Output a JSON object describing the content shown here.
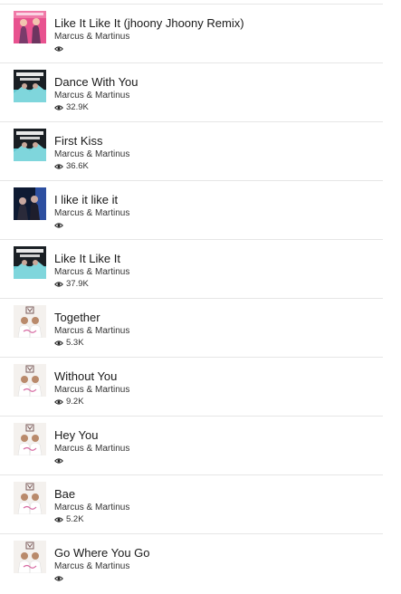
{
  "tracks": [
    {
      "title": "Like It Like It (jhoony Jhoony Remix)",
      "artist": "Marcus & Martinus",
      "plays": "",
      "art": "pink"
    },
    {
      "title": "Dance With You",
      "artist": "Marcus & Martinus",
      "plays": "32.9K",
      "art": "moment"
    },
    {
      "title": "First Kiss",
      "artist": "Marcus & Martinus",
      "plays": "36.6K",
      "art": "moment"
    },
    {
      "title": "I like it like it",
      "artist": "Marcus & Martinus",
      "plays": "",
      "art": "dark"
    },
    {
      "title": "Like It Like It",
      "artist": "Marcus & Martinus",
      "plays": "37.9K",
      "art": "moment"
    },
    {
      "title": "Together",
      "artist": "Marcus & Martinus",
      "plays": "5.3K",
      "art": "light"
    },
    {
      "title": "Without You",
      "artist": "Marcus & Martinus",
      "plays": "9.2K",
      "art": "light"
    },
    {
      "title": "Hey You",
      "artist": "Marcus & Martinus",
      "plays": "",
      "art": "light"
    },
    {
      "title": "Bae",
      "artist": "Marcus & Martinus",
      "plays": "5.2K",
      "art": "light"
    },
    {
      "title": "Go Where You Go",
      "artist": "Marcus & Martinus",
      "plays": "",
      "art": "light"
    }
  ],
  "icons": {
    "plays": "eye-icon"
  },
  "colors": {
    "divider": "#e6e6e6",
    "text": "#1a1a1a"
  }
}
